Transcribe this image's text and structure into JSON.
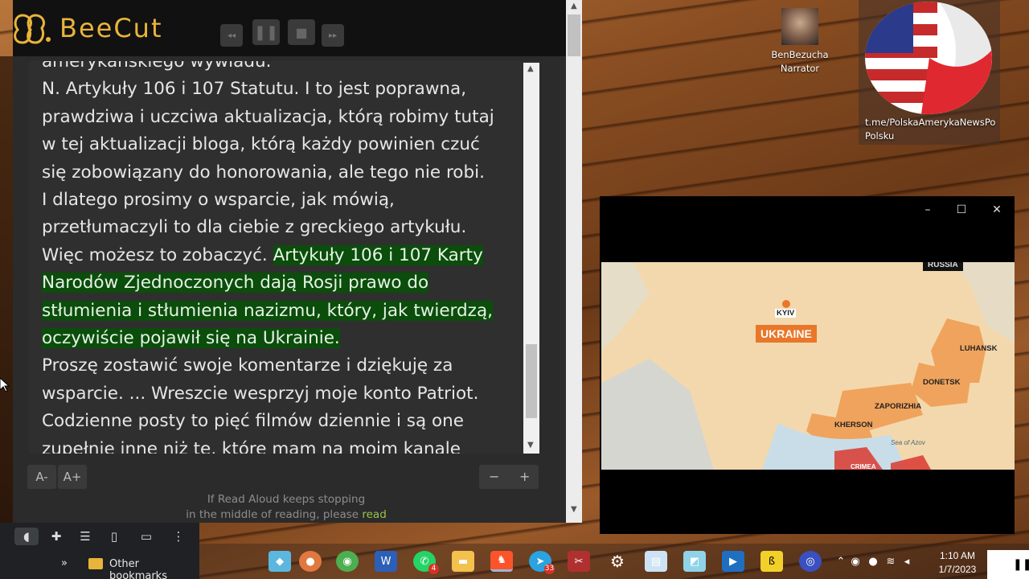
{
  "app": {
    "name": "BeeCut"
  },
  "reader": {
    "text_partial_top": "amerykańskiego wywiadu.",
    "text_lines_plain": [
      "N. Artykuły 106 i 107 Statutu. I to jest poprawna,",
      "prawdziwa i uczciwa aktualizacja, którą robimy tutaj",
      "w tej aktualizacji bloga, którą każdy powinien czuć",
      "się zobowiązany do honorowania, ale tego nie robi.",
      "I dlatego prosimy o wsparcie, jak mówią,",
      "przetłumaczyli to dla ciebie z greckiego artykułu."
    ],
    "line_before_hl": "Więc możesz to zobaczyć. ",
    "highlight_lines": [
      "Artykuły 106 i 107 Karty",
      "Narodów Zjednoczonych dają Rosji prawo do",
      "stłumienia i stłumienia nazizmu, który, jak twierdzą,",
      "oczywiście pojawił się na Ukrainie."
    ],
    "text_lines_after": [
      "Proszę zostawić swoje komentarze i dziękuję za",
      "wsparcie. ... Wreszcie wesprzyj moje konto Patriot.",
      "Codzienne posty to pięć filmów dziennie i są one",
      "zupełnie inne niż te, które mam na moim kanale"
    ],
    "font_decrease": "A-",
    "font_increase": "A+",
    "zoom_minus": "−",
    "zoom_plus": "+",
    "footer_line1": "If Read Aloud keeps stopping",
    "footer_line2": "in the middle of reading, please ",
    "footer_link": "read"
  },
  "desktop": {
    "narrator_name": "BenBezucha",
    "narrator_role": "Narrator",
    "flag_caption_1": "t.me/PolskaAmerykaNewsPo",
    "flag_caption_2": "Polsku"
  },
  "video_window": {
    "minimize": "–",
    "maximize": "☐",
    "close": "✕"
  },
  "map": {
    "labels": {
      "russia": "RUSSIA",
      "kyiv": "KYIV",
      "ukraine": "UKRAINE",
      "luhansk": "LUHANSK",
      "donetsk": "DONETSK",
      "zaporizhia": "ZAPORIZHIA",
      "kherson": "KHERSON",
      "sea": "Sea of Azov",
      "crimea": "CRIMEA"
    }
  },
  "browser": {
    "other_bookmarks": "Other bookmarks",
    "chevron": "»"
  },
  "taskbar": {
    "whatsapp_badge": "4",
    "telegram_badge": "33",
    "time": "1:10 AM",
    "date": "1/7/2023"
  },
  "colors": {
    "highlight": "#0b4d0b",
    "logo": "#e8b43a",
    "ukraine_orange": "#e9772a",
    "occupied": "#f0a35c"
  }
}
